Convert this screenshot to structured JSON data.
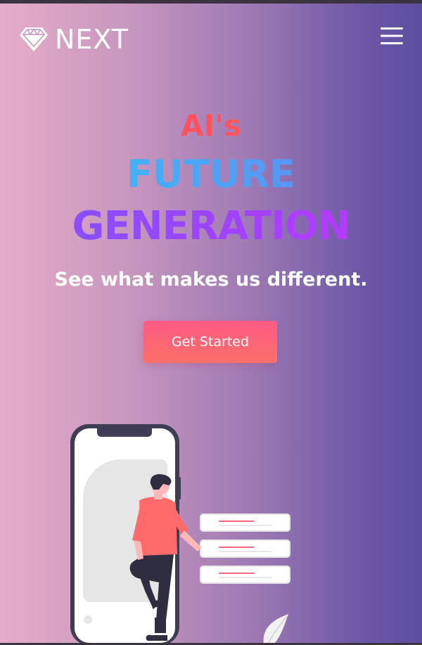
{
  "header": {
    "brand": "NEXT",
    "logo_icon": "diamond-icon",
    "menu_icon": "hamburger-menu-icon"
  },
  "hero": {
    "line1": "AI's",
    "line2": "FUTURE",
    "line3": "GENERATION",
    "tagline": "See what makes us different.",
    "cta_label": "Get Started"
  },
  "colors": {
    "background_left": "#e6adc7",
    "background_right": "#5f4e9f",
    "line1": "#ff3b66",
    "line2": "#3fb8f7",
    "line3": "#9b45ff",
    "cta": "#fe5a86"
  }
}
